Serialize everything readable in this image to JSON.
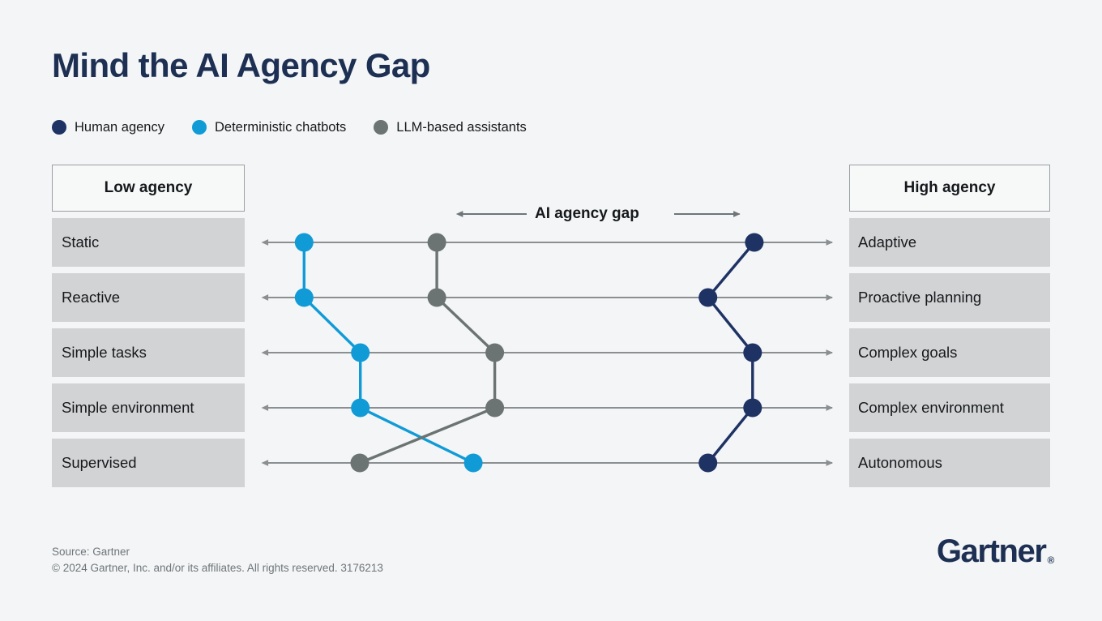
{
  "title": "Mind the AI Agency Gap",
  "colors": {
    "background": "#f4f5f6",
    "navy": "#1e3264",
    "blue": "#109bd7",
    "gray": "#6b7472",
    "band": "#d2d3d4",
    "axis": "#8b8f91",
    "header_border": "#9aa0a3",
    "title": "#1d3053"
  },
  "legend": {
    "items": [
      {
        "label": "Human agency",
        "color": "#1e3264",
        "key": "human"
      },
      {
        "label": "Deterministic chatbots",
        "color": "#109bd7",
        "key": "chatbots"
      },
      {
        "label": "LLM-based assistants",
        "color": "#6b7472",
        "key": "llm"
      }
    ]
  },
  "axis_headers": {
    "left": "Low agency",
    "right": "High agency"
  },
  "gap_annotation": {
    "label": "AI agency gap",
    "left_arrow": "left-arrow",
    "right_arrow": "right-arrow"
  },
  "footer": {
    "source": "Source: Gartner",
    "copyright": "© 2024 Gartner, Inc. and/or its affiliates. All rights reserved. 3176213",
    "logo": "Gartner",
    "logo_mark": "®"
  },
  "chart_data": {
    "type": "line",
    "title": "Mind the AI Agency Gap",
    "xlabel": "",
    "ylabel": "",
    "grid": false,
    "legend_position": "top-left",
    "x_axis": {
      "low_label": "Low agency",
      "high_label": "High agency",
      "range": [
        0,
        1
      ],
      "direction": "low-to-high",
      "arrows": "both"
    },
    "categories": [
      {
        "low": "Static",
        "high": "Adaptive"
      },
      {
        "low": "Reactive",
        "high": "Proactive planning"
      },
      {
        "low": "Simple tasks",
        "high": "Complex goals"
      },
      {
        "low": "Simple environment",
        "high": "Complex environment"
      },
      {
        "low": "Supervised",
        "high": "Autonomous"
      }
    ],
    "series": [
      {
        "name": "Deterministic chatbots",
        "color": "#109bd7",
        "values": [
          0.076,
          0.076,
          0.173,
          0.173,
          0.368
        ]
      },
      {
        "name": "LLM-based assistants",
        "color": "#6b7472",
        "values": [
          0.305,
          0.305,
          0.405,
          0.405,
          0.172
        ]
      },
      {
        "name": "Human agency",
        "color": "#1e3264",
        "values": [
          0.853,
          0.773,
          0.85,
          0.85,
          0.773
        ]
      }
    ],
    "annotations": [
      {
        "text": "AI agency gap",
        "type": "double-arrow",
        "from": 0.336,
        "to": 0.84
      }
    ]
  }
}
